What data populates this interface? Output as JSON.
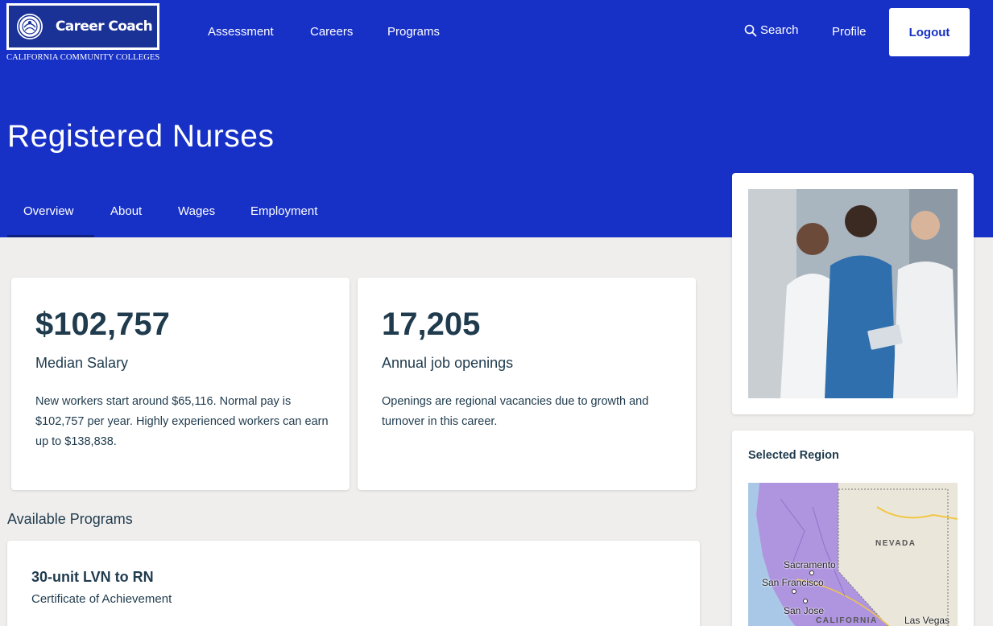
{
  "brand": {
    "name": "Career Coach",
    "subtitle": "CALIFORNIA COMMUNITY COLLEGES",
    "colors": {
      "primary": "#1730c6",
      "logo_blue": "#1a3196",
      "text": "#1f3b4d",
      "background": "#efeeec"
    }
  },
  "nav": {
    "items": [
      "Assessment",
      "Careers",
      "Programs"
    ],
    "search_label": "Search",
    "profile_label": "Profile",
    "logout_label": "Logout"
  },
  "page": {
    "title": "Registered Nurses",
    "tabs": [
      "Overview",
      "About",
      "Wages",
      "Employment"
    ],
    "active_tab": "Overview"
  },
  "stats": [
    {
      "value": "$102,757",
      "label": "Median Salary",
      "description": "New workers start around $65,116. Normal pay is $102,757 per year. Highly experienced workers can earn up to $138,838."
    },
    {
      "value": "17,205",
      "label": "Annual job openings",
      "description": "Openings are regional vacancies due to growth and turnover in this career."
    }
  ],
  "programs": {
    "heading": "Available Programs",
    "items": [
      {
        "title": "30-unit LVN to RN",
        "type": "Certificate of Achievement"
      }
    ]
  },
  "region": {
    "label": "Selected Region",
    "map_labels": {
      "state_nevada": "NEVADA",
      "state_california": "CALIFORNIA",
      "cities": [
        "Sacramento",
        "San Francisco",
        "San Jose",
        "Las Vegas"
      ]
    }
  }
}
